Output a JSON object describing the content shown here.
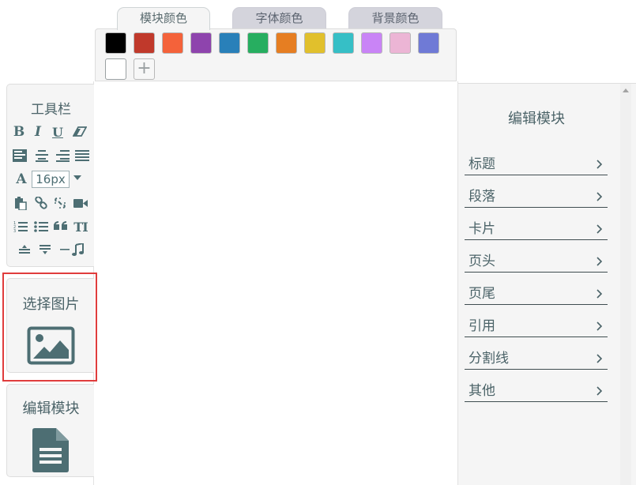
{
  "color_tabs": [
    {
      "label": "模块颜色",
      "active": true
    },
    {
      "label": "字体颜色",
      "active": false
    },
    {
      "label": "背景颜色",
      "active": false
    }
  ],
  "palette": {
    "colors": [
      "#000000",
      "#c0392b",
      "#f4623a",
      "#8e44ad",
      "#2980b9",
      "#27ae60",
      "#e67e22",
      "#e1c02c",
      "#36bfc6",
      "#c984f6",
      "#ecb5d5",
      "#6f7ad6",
      "#ffffff"
    ],
    "add_symbol": "+"
  },
  "toolbar": {
    "title": "工具栏",
    "font_size": "16px",
    "icon_color": "#4d6e73"
  },
  "select_image": {
    "label": "选择图片"
  },
  "edit_module_panel": {
    "label": "编辑模块"
  },
  "right_panel": {
    "title": "编辑模块",
    "items": [
      "标题",
      "段落",
      "卡片",
      "页头",
      "页尾",
      "引用",
      "分割线",
      "其他"
    ]
  },
  "accent": {
    "highlight": "#e03c3c"
  }
}
